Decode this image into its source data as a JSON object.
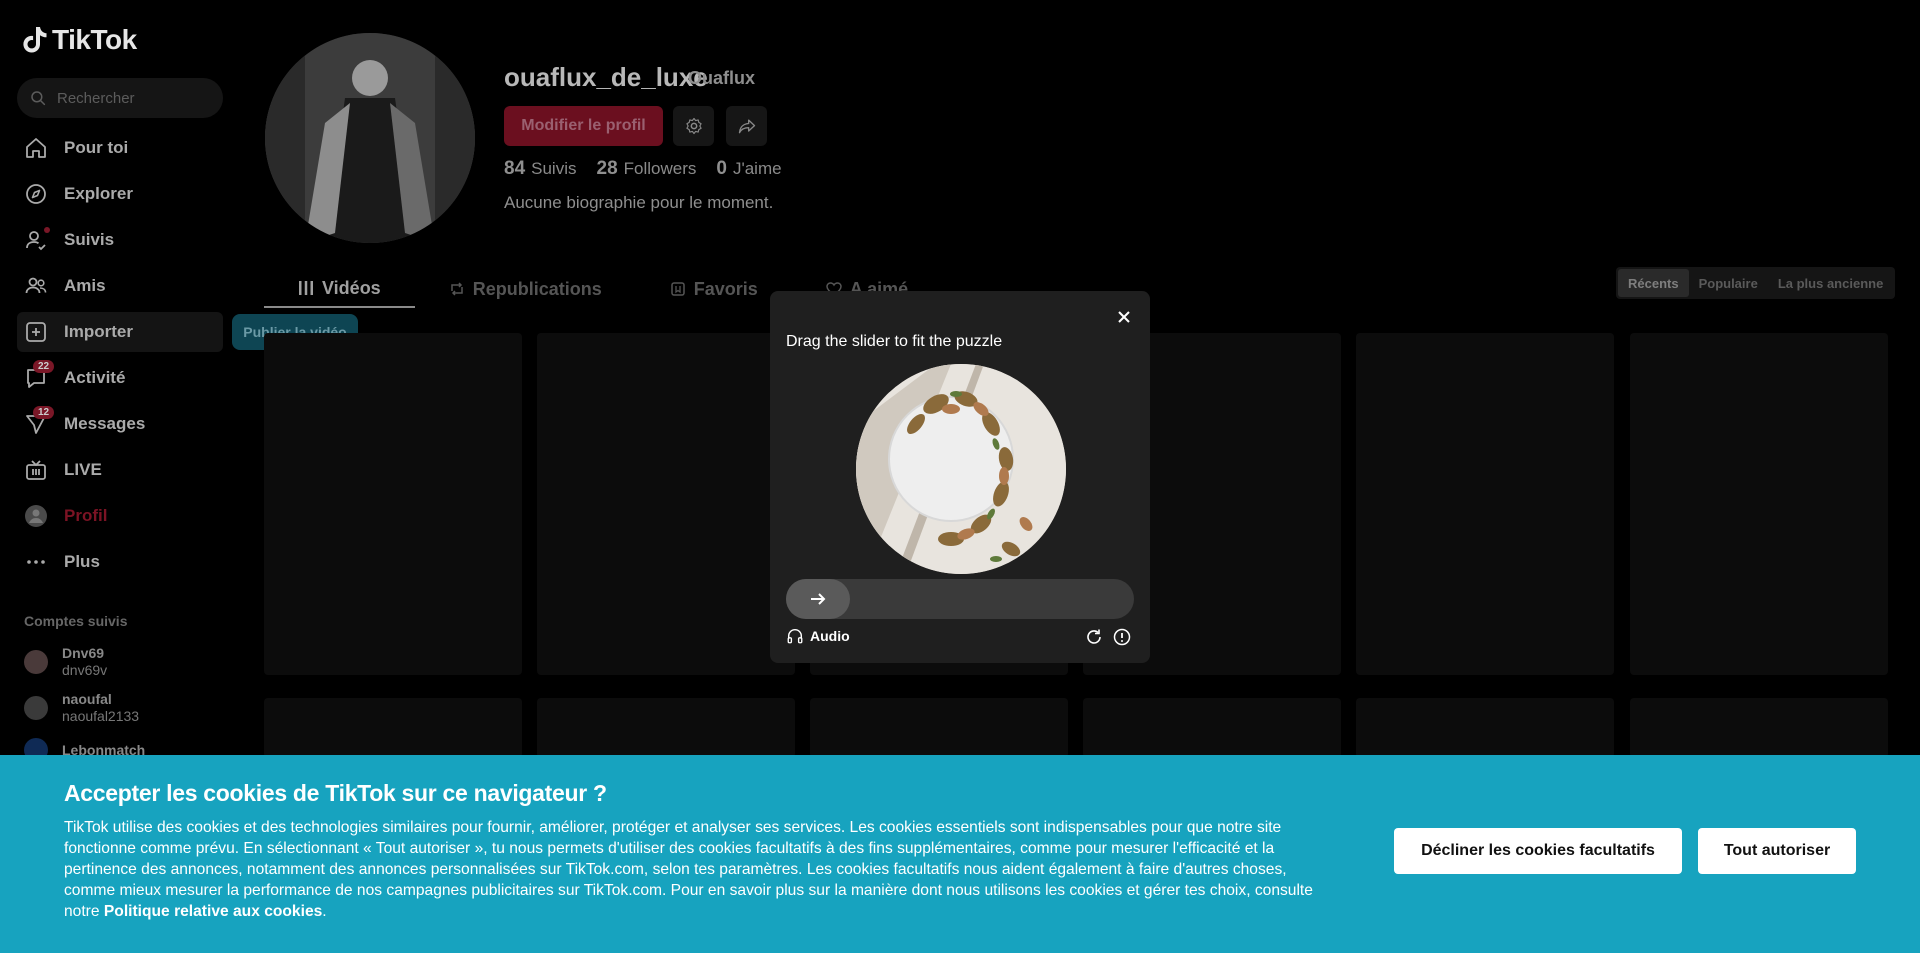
{
  "app": {
    "logo_text": "TikTok"
  },
  "search": {
    "placeholder": "Rechercher"
  },
  "sidebar": {
    "items": [
      {
        "label": "Pour toi",
        "icon": "home-icon"
      },
      {
        "label": "Explorer",
        "icon": "compass-icon"
      },
      {
        "label": "Suivis",
        "icon": "following-icon"
      },
      {
        "label": "Amis",
        "icon": "friends-icon"
      },
      {
        "label": "Importer",
        "icon": "upload-icon"
      },
      {
        "label": "Activité",
        "icon": "activity-icon",
        "badge": "22"
      },
      {
        "label": "Messages",
        "icon": "messages-icon",
        "badge": "12"
      },
      {
        "label": "LIVE",
        "icon": "live-icon"
      },
      {
        "label": "Profil",
        "icon": "profile-icon"
      },
      {
        "label": "Plus",
        "icon": "more-icon"
      }
    ],
    "publish_tip": "Publier la vidéo",
    "following_title": "Comptes suivis",
    "accounts": [
      {
        "name": "Dnv69",
        "handle": "dnv69v"
      },
      {
        "name": "naoufal",
        "handle": "naoufal2133"
      },
      {
        "name": "Lebonmatch",
        "handle": ""
      }
    ]
  },
  "profile": {
    "username": "ouaflux_de_luxe",
    "nickname": "Ouaflux",
    "edit_label": "Modifier le profil",
    "stats": {
      "following_count": "84",
      "following_label": "Suivis",
      "followers_count": "28",
      "followers_label": "Followers",
      "likes_count": "0",
      "likes_label": "J'aime"
    },
    "bio": "Aucune biographie pour le moment."
  },
  "tabs": [
    "Vidéos",
    "Republications",
    "Favoris",
    "A aimé"
  ],
  "sort": [
    "Récents",
    "Populaire",
    "La plus ancienne"
  ],
  "captcha": {
    "title": "Drag the slider to fit the puzzle",
    "audio_label": "Audio"
  },
  "cookie": {
    "title": "Accepter les cookies de TikTok sur ce navigateur ?",
    "body": "TikTok utilise des cookies et des technologies similaires pour fournir, améliorer, protéger et analyser ses services. Les cookies essentiels sont indispensables pour que notre site fonctionne comme prévu. En sélectionnant « Tout autoriser », tu nous permets d'utiliser des cookies facultatifs à des fins supplémentaires, comme pour mesurer l'efficacité et la pertinence des annonces, notamment des annonces personnalisées sur TikTok.com, selon tes paramètres. Les cookies facultatifs nous aident également à faire d'autres choses, comme mieux mesurer la performance de nos campagnes publicitaires sur TikTok.com. Pour en savoir plus sur la manière dont nous utilisons les cookies et gérer tes choix, consulte notre ",
    "policy_link": "Politique relative aux cookies",
    "decline_label": "Décliner les cookies facultatifs",
    "accept_label": "Tout autoriser"
  },
  "colors": {
    "accent_red": "#fe2c55",
    "cookie_banner": "#17a3bf",
    "modal_bg": "#1f1f1f"
  }
}
